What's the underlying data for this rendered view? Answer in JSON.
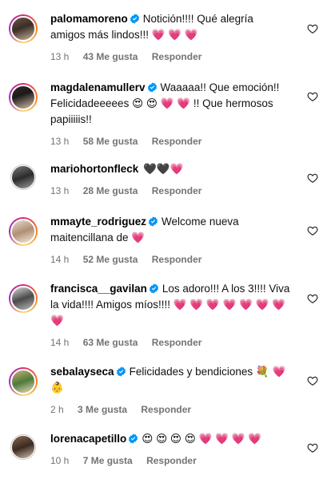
{
  "comments": [
    {
      "username": "palomamoreno",
      "verified": true,
      "text": "Notición!!!! Qué alegría amigos más lindos!!! 💗 💗 💗",
      "time": "13 h",
      "likes": "43 Me gusta",
      "reply": "Responder"
    },
    {
      "username": "magdalenamullerv",
      "verified": true,
      "text": "Waaaaa!! Que emoción!! Felicidadeeeees 😍 😍 💗 💗 !! Que hermosos papiiiiis!!",
      "time": "13 h",
      "likes": "58 Me gusta",
      "reply": "Responder"
    },
    {
      "username": "mariohortonfleck",
      "verified": false,
      "text": "🖤🖤💗",
      "time": "13 h",
      "likes": "28 Me gusta",
      "reply": "Responder"
    },
    {
      "username": "mmayte_rodriguez",
      "verified": true,
      "text": "Welcome nueva maitencillana de 💗",
      "time": "14 h",
      "likes": "52 Me gusta",
      "reply": "Responder"
    },
    {
      "username": "francisca__gavilan",
      "verified": true,
      "text": "Los adoro!!! A los 3!!!! Viva la vida!!!! Amigos míos!!!! 💗 💗 💗 💗 💗 💗 💗 💗",
      "time": "14 h",
      "likes": "63 Me gusta",
      "reply": "Responder"
    },
    {
      "username": "sebalayseca",
      "verified": true,
      "text": "Felicidades y bendiciones 💐 💗 👶",
      "time": "2 h",
      "likes": "3 Me gusta",
      "reply": "Responder"
    },
    {
      "username": "lorenacapetillo",
      "verified": true,
      "text": "😍 😍 😍 😍 💗 💗 💗 💗",
      "time": "10 h",
      "likes": "7 Me gusta",
      "reply": "Responder"
    }
  ],
  "colors": {
    "verified": "#0095f6",
    "meta": "#737373",
    "heart_emoji": "#f0246f"
  },
  "icons": {
    "like": "heart-outline-icon",
    "verified": "verified-badge-icon"
  }
}
